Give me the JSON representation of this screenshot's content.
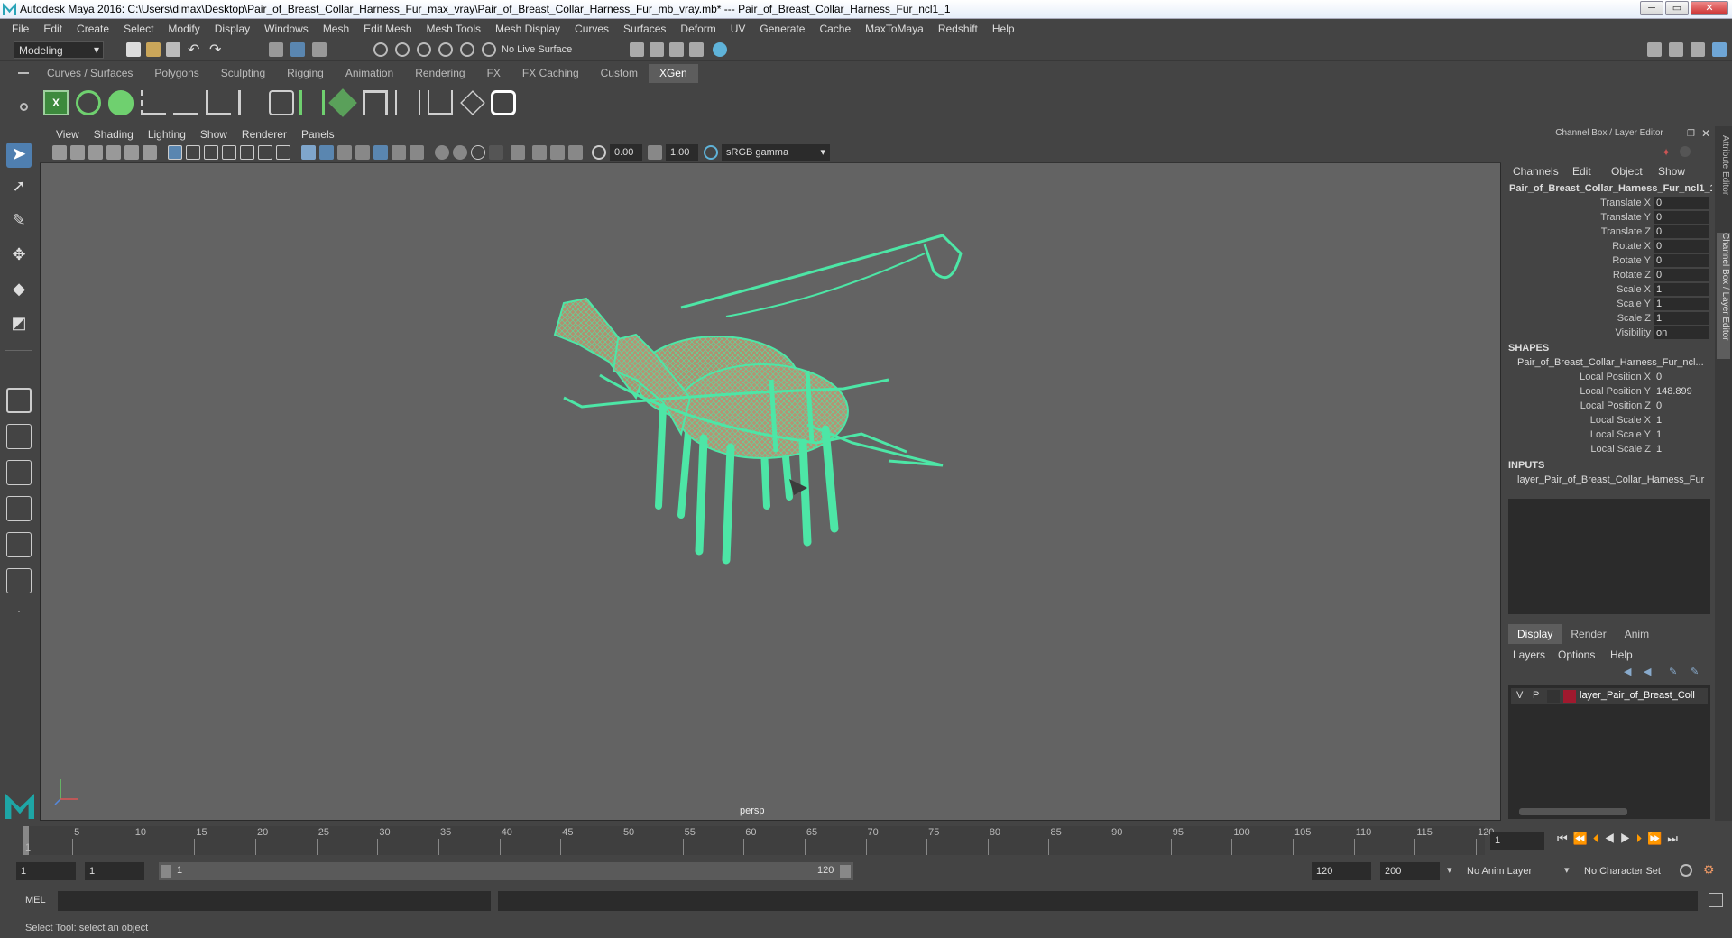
{
  "window": {
    "title": "Autodesk Maya 2016: C:\\Users\\dimax\\Desktop\\Pair_of_Breast_Collar_Harness_Fur_max_vray\\Pair_of_Breast_Collar_Harness_Fur_mb_vray.mb*   ---   Pair_of_Breast_Collar_Harness_Fur_ncl1_1"
  },
  "menubar": [
    "File",
    "Edit",
    "Create",
    "Select",
    "Modify",
    "Display",
    "Windows",
    "Mesh",
    "Edit Mesh",
    "Mesh Tools",
    "Mesh Display",
    "Curves",
    "Surfaces",
    "Deform",
    "UV",
    "Generate",
    "Cache",
    "MaxToMaya",
    "Redshift",
    "Help"
  ],
  "statusline": {
    "mode": "Modeling",
    "live_surface": "No Live Surface"
  },
  "shelf_tabs": [
    "Curves / Surfaces",
    "Polygons",
    "Sculpting",
    "Rigging",
    "Animation",
    "Rendering",
    "FX",
    "FX Caching",
    "Custom",
    "XGen"
  ],
  "active_shelf_tab": "XGen",
  "viewport": {
    "menus": [
      "View",
      "Shading",
      "Lighting",
      "Show",
      "Renderer",
      "Panels"
    ],
    "exposure": "0.00",
    "gamma": "1.00",
    "color_space": "sRGB gamma",
    "camera_label": "persp"
  },
  "channel_box": {
    "header": "Channel Box / Layer Editor",
    "menus": [
      "Channels",
      "Edit",
      "Object",
      "Show"
    ],
    "object_name": "Pair_of_Breast_Collar_Harness_Fur_ncl1_1",
    "attributes": [
      {
        "label": "Translate X",
        "value": "0"
      },
      {
        "label": "Translate Y",
        "value": "0"
      },
      {
        "label": "Translate Z",
        "value": "0"
      },
      {
        "label": "Rotate X",
        "value": "0"
      },
      {
        "label": "Rotate Y",
        "value": "0"
      },
      {
        "label": "Rotate Z",
        "value": "0"
      },
      {
        "label": "Scale X",
        "value": "1"
      },
      {
        "label": "Scale Y",
        "value": "1"
      },
      {
        "label": "Scale Z",
        "value": "1"
      },
      {
        "label": "Visibility",
        "value": "on"
      }
    ],
    "shapes_title": "SHAPES",
    "shape_name": "Pair_of_Breast_Collar_Harness_Fur_ncl...",
    "shape_attributes": [
      {
        "label": "Local Position X",
        "value": "0"
      },
      {
        "label": "Local Position Y",
        "value": "148.899"
      },
      {
        "label": "Local Position Z",
        "value": "0"
      },
      {
        "label": "Local Scale X",
        "value": "1"
      },
      {
        "label": "Local Scale Y",
        "value": "1"
      },
      {
        "label": "Local Scale Z",
        "value": "1"
      }
    ],
    "inputs_title": "INPUTS",
    "input_name": "layer_Pair_of_Breast_Collar_Harness_Fur"
  },
  "layer_editor": {
    "tabs": [
      "Display",
      "Render",
      "Anim"
    ],
    "active_tab": "Display",
    "menus": [
      "Layers",
      "Options",
      "Help"
    ],
    "layer": {
      "v": "V",
      "p": "P",
      "name": "layer_Pair_of_Breast_Coll",
      "color": "#a0192e"
    }
  },
  "side_tabs": [
    "Attribute Editor",
    "Channel Box / Layer Editor"
  ],
  "timeline": {
    "ticks": [
      "1",
      "5",
      "10",
      "15",
      "20",
      "25",
      "30",
      "35",
      "40",
      "45",
      "50",
      "55",
      "60",
      "65",
      "70",
      "75",
      "80",
      "85",
      "90",
      "95",
      "100",
      "105",
      "110",
      "115",
      "120"
    ],
    "current_frame": "1"
  },
  "range": {
    "start": "1",
    "playback_start": "1",
    "slider_start": "1",
    "slider_end": "120",
    "playback_end": "120",
    "end": "200",
    "anim_layer": "No Anim Layer",
    "character_set": "No Character Set"
  },
  "command_line": {
    "label": "MEL"
  },
  "help_line": "Select Tool: select an object",
  "colors": {
    "wireframe": "#4de6a6",
    "body": "#b09070"
  }
}
